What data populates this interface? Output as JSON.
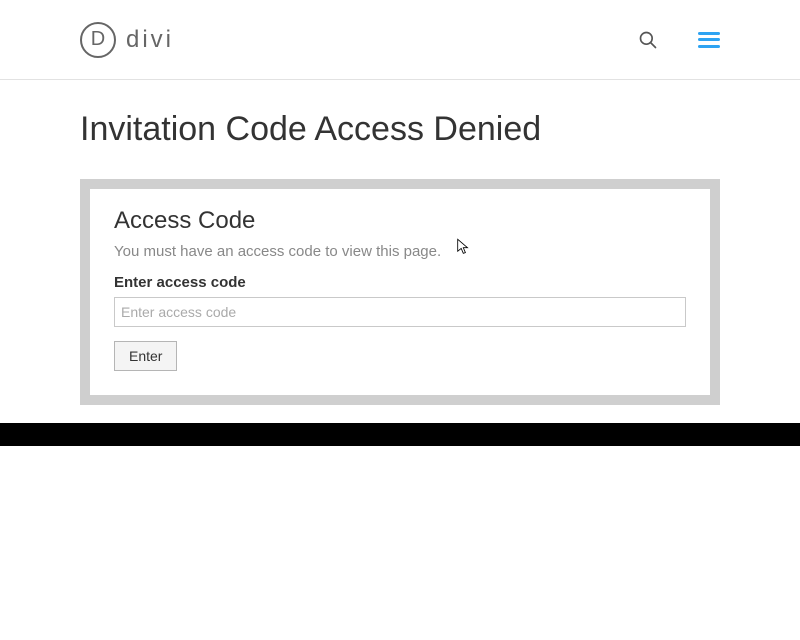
{
  "brand": {
    "mark_letter": "D",
    "name": "divi",
    "accent": "#2ea3f2"
  },
  "page": {
    "title": "Invitation Code Access Denied"
  },
  "access_card": {
    "heading": "Access Code",
    "description": "You must have an access code to view this page.",
    "field_label": "Enter access code",
    "input_placeholder": "Enter access code",
    "input_value": "",
    "submit_label": "Enter"
  }
}
